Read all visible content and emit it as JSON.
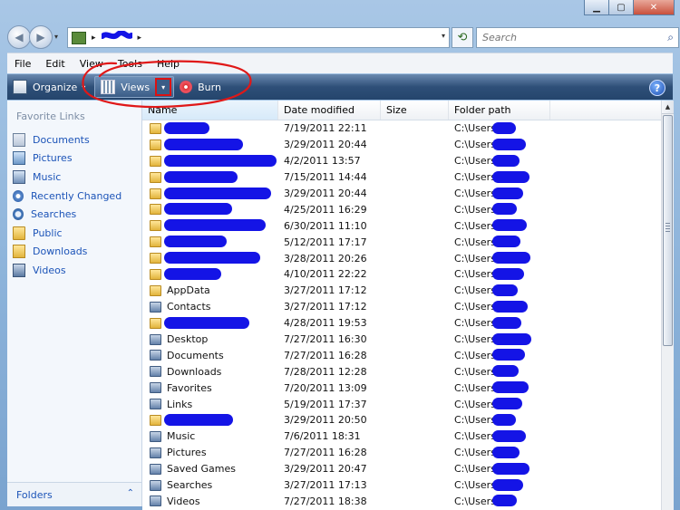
{
  "window": {
    "minimize_icon": "minimize-icon",
    "maximize_icon": "maximize-icon",
    "close_icon": "close-icon"
  },
  "address": {
    "back_glyph": "◀",
    "forward_glyph": "▶",
    "breadcrumb_sep": "▸",
    "breadcrumb_end": "▸",
    "refresh_glyph": "⟲",
    "search_placeholder": "Search",
    "search_glyph": "⌕"
  },
  "menu": [
    "File",
    "Edit",
    "View",
    "Tools",
    "Help"
  ],
  "toolbar": {
    "organize_label": "Organize",
    "views_label": "Views",
    "burn_label": "Burn",
    "help_glyph": "?",
    "caret_glyph": "▾"
  },
  "nav": {
    "title": "Favorite Links",
    "items": [
      {
        "label": "Documents",
        "icon": "documents-icon"
      },
      {
        "label": "Pictures",
        "icon": "pictures-icon"
      },
      {
        "label": "Music",
        "icon": "music-icon"
      },
      {
        "label": "Recently Changed",
        "icon": "recently-changed-icon"
      },
      {
        "label": "Searches",
        "icon": "searches-icon"
      },
      {
        "label": "Public",
        "icon": "public-folder-icon"
      },
      {
        "label": "Downloads",
        "icon": "downloads-icon"
      },
      {
        "label": "Videos",
        "icon": "videos-icon"
      }
    ],
    "folders_label": "Folders",
    "folders_chevron": "⌃"
  },
  "columns": {
    "name": "Name",
    "date": "Date modified",
    "size": "Size",
    "path": "Folder path"
  },
  "rows": [
    {
      "name": "",
      "date": "7/19/2011 22:11",
      "path": "C:\\Users\\",
      "redacted_name": true
    },
    {
      "name": "",
      "date": "3/29/2011 20:44",
      "path": "C:\\Users\\",
      "redacted_name": true
    },
    {
      "name": "",
      "date": "4/2/2011 13:57",
      "path": "C:\\Users\\",
      "redacted_name": true
    },
    {
      "name": "",
      "date": "7/15/2011 14:44",
      "path": "C:\\Users\\",
      "redacted_name": true
    },
    {
      "name": "",
      "date": "3/29/2011 20:44",
      "path": "C:\\Users\\",
      "redacted_name": true
    },
    {
      "name": "",
      "date": "4/25/2011 16:29",
      "path": "C:\\Users\\",
      "redacted_name": true
    },
    {
      "name": "",
      "date": "6/30/2011 11:10",
      "path": "C:\\Users\\",
      "redacted_name": true
    },
    {
      "name": "",
      "date": "5/12/2011 17:17",
      "path": "C:\\Users\\",
      "redacted_name": true
    },
    {
      "name": "",
      "date": "3/28/2011 20:26",
      "path": "C:\\Users\\",
      "redacted_name": true
    },
    {
      "name": "",
      "date": "4/10/2011 22:22",
      "path": "C:\\Users\\",
      "redacted_name": true
    },
    {
      "name": "AppData",
      "date": "3/27/2011 17:12",
      "path": "C:\\Users\\",
      "redacted_name": false
    },
    {
      "name": "Contacts",
      "date": "3/27/2011 17:12",
      "path": "C:\\Users\\",
      "redacted_name": false
    },
    {
      "name": "",
      "date": "4/28/2011 19:53",
      "path": "C:\\Users\\",
      "redacted_name": true
    },
    {
      "name": "Desktop",
      "date": "7/27/2011 16:30",
      "path": "C:\\Users\\",
      "redacted_name": false
    },
    {
      "name": "Documents",
      "date": "7/27/2011 16:28",
      "path": "C:\\Users\\",
      "redacted_name": false
    },
    {
      "name": "Downloads",
      "date": "7/28/2011 12:28",
      "path": "C:\\Users\\",
      "redacted_name": false
    },
    {
      "name": "Favorites",
      "date": "7/20/2011 13:09",
      "path": "C:\\Users\\",
      "redacted_name": false
    },
    {
      "name": "Links",
      "date": "5/19/2011 17:37",
      "path": "C:\\Users\\",
      "redacted_name": false
    },
    {
      "name": "",
      "date": "3/29/2011 20:50",
      "path": "C:\\Users\\",
      "redacted_name": true
    },
    {
      "name": "Music",
      "date": "7/6/2011 18:31",
      "path": "C:\\Users\\",
      "redacted_name": false
    },
    {
      "name": "Pictures",
      "date": "7/27/2011 16:28",
      "path": "C:\\Users\\",
      "redacted_name": false
    },
    {
      "name": "Saved Games",
      "date": "3/29/2011 20:47",
      "path": "C:\\Users\\",
      "redacted_name": false
    },
    {
      "name": "Searches",
      "date": "3/27/2011 17:13",
      "path": "C:\\Users\\",
      "redacted_name": false
    },
    {
      "name": "Videos",
      "date": "7/27/2011 18:38",
      "path": "C:\\Users\\",
      "redacted_name": false
    }
  ],
  "colors": {
    "redaction": "#1414e6",
    "annotation": "#e01818",
    "nav_link": "#1c54b8"
  }
}
